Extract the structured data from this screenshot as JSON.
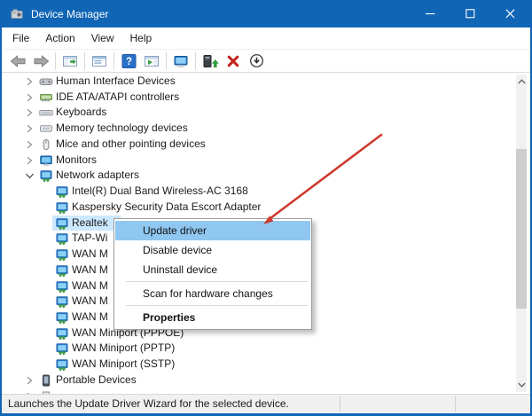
{
  "window": {
    "title": "Device Manager"
  },
  "titlebar": {
    "controls": [
      "minimize-icon",
      "maximize-icon",
      "close-icon"
    ]
  },
  "menubar": {
    "items": [
      "File",
      "Action",
      "View",
      "Help"
    ]
  },
  "toolbar": {
    "items": [
      "back-icon",
      "forward-icon",
      "separator",
      "show-console-tree-icon",
      "separator",
      "properties-icon",
      "separator",
      "help-icon",
      "show-action-pane-icon",
      "separator",
      "computer-icon",
      "separator",
      "update-driver-icon",
      "uninstall-icon",
      "disable-icon"
    ]
  },
  "tree": {
    "items": [
      {
        "label": "Human Interface Devices",
        "level": 1,
        "state": "collapsed",
        "icon": "hid-icon",
        "selected": false
      },
      {
        "label": "IDE ATA/ATAPI controllers",
        "level": 1,
        "state": "collapsed",
        "icon": "ide-icon",
        "selected": false
      },
      {
        "label": "Keyboards",
        "level": 1,
        "state": "collapsed",
        "icon": "keyboard-icon",
        "selected": false
      },
      {
        "label": "Memory technology devices",
        "level": 1,
        "state": "collapsed",
        "icon": "memory-icon",
        "selected": false
      },
      {
        "label": "Mice and other pointing devices",
        "level": 1,
        "state": "collapsed",
        "icon": "mouse-icon",
        "selected": false
      },
      {
        "label": "Monitors",
        "level": 1,
        "state": "collapsed",
        "icon": "monitor-icon",
        "selected": false
      },
      {
        "label": "Network adapters",
        "level": 1,
        "state": "expanded",
        "icon": "network-adapter-icon",
        "selected": false
      },
      {
        "label": "Intel(R) Dual Band Wireless-AC 3168",
        "level": 2,
        "state": "none",
        "icon": "network-adapter-icon",
        "selected": false
      },
      {
        "label": "Kaspersky Security Data Escort Adapter",
        "level": 2,
        "state": "none",
        "icon": "network-adapter-icon",
        "selected": false
      },
      {
        "label": "Realtek",
        "level": 2,
        "state": "none",
        "icon": "network-adapter-icon",
        "selected": true
      },
      {
        "label": "TAP-Wi",
        "level": 2,
        "state": "none",
        "icon": "network-adapter-icon",
        "selected": false
      },
      {
        "label": "WAN M",
        "level": 2,
        "state": "none",
        "icon": "network-adapter-icon",
        "selected": false
      },
      {
        "label": "WAN M",
        "level": 2,
        "state": "none",
        "icon": "network-adapter-icon",
        "selected": false
      },
      {
        "label": "WAN M",
        "level": 2,
        "state": "none",
        "icon": "network-adapter-icon",
        "selected": false
      },
      {
        "label": "WAN M",
        "level": 2,
        "state": "none",
        "icon": "network-adapter-icon",
        "selected": false
      },
      {
        "label": "WAN M",
        "level": 2,
        "state": "none",
        "icon": "network-adapter-icon",
        "selected": false
      },
      {
        "label": "WAN Miniport (PPPOE)",
        "level": 2,
        "state": "none",
        "icon": "network-adapter-icon",
        "selected": false
      },
      {
        "label": "WAN Miniport (PPTP)",
        "level": 2,
        "state": "none",
        "icon": "network-adapter-icon",
        "selected": false
      },
      {
        "label": "WAN Miniport (SSTP)",
        "level": 2,
        "state": "none",
        "icon": "network-adapter-icon",
        "selected": false
      },
      {
        "label": "Portable Devices",
        "level": 1,
        "state": "collapsed",
        "icon": "portable-icon",
        "selected": false
      },
      {
        "label": "",
        "level": 1,
        "state": "collapsed",
        "icon": "printer-icon",
        "selected": false
      }
    ]
  },
  "context_menu": {
    "items": [
      {
        "label": "Update driver",
        "highlighted": true,
        "bold": false
      },
      {
        "label": "Disable device",
        "highlighted": false,
        "bold": false
      },
      {
        "label": "Uninstall device",
        "highlighted": false,
        "bold": false
      },
      {
        "separator": true
      },
      {
        "label": "Scan for hardware changes",
        "highlighted": false,
        "bold": false
      },
      {
        "separator": true
      },
      {
        "label": "Properties",
        "highlighted": false,
        "bold": true
      }
    ]
  },
  "status_bar": {
    "text": "Launches the Update Driver Wizard for the selected device."
  },
  "annotation": {
    "arrow_color": "#ce3a30"
  },
  "colors": {
    "titlebar": "#1065b5",
    "menu_highlight": "#8fc7f0",
    "tree_selection": "#cce8ff",
    "window_border": "#1065b5"
  }
}
